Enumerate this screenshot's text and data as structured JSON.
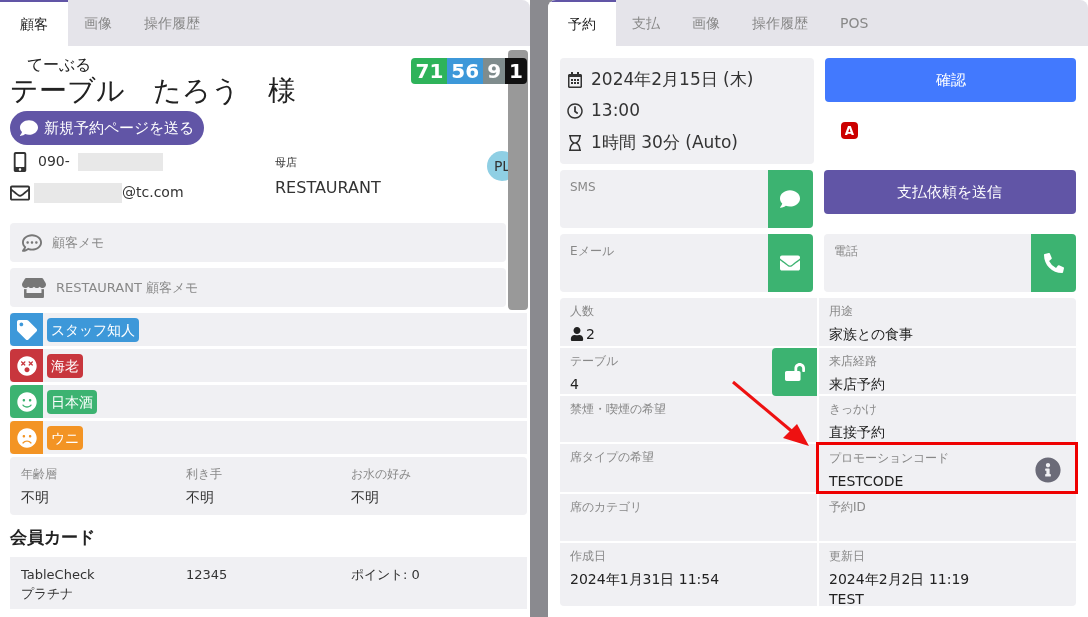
{
  "left_panel": {
    "tabs": [
      {
        "label": "顧客",
        "selected": true
      },
      {
        "label": "画像",
        "selected": false
      },
      {
        "label": "操作履歴",
        "selected": false
      }
    ],
    "customer": {
      "furigana": "てーぶる",
      "name": "テーブル　たろう　様",
      "scores": [
        {
          "value": "71",
          "color": "#2eb35a"
        },
        {
          "value": "56",
          "color": "#3d98d9"
        },
        {
          "value": "9",
          "color": "#7f8c8d"
        },
        {
          "value": "1",
          "color": "#111111"
        }
      ],
      "send_button": "新規予約ページを送る",
      "phone": "090-",
      "email": "@tc.com",
      "home_store": {
        "label": "母店",
        "value": "RESTAURANT"
      },
      "avatar": "PL"
    },
    "memos": [
      {
        "kind": "chat",
        "text": "顧客メモ"
      },
      {
        "kind": "store",
        "text": "RESTAURANT 顧客メモ"
      }
    ],
    "tags": [
      {
        "kind": "tag",
        "label": "スタッフ知人",
        "color": "#3d98d9"
      },
      {
        "kind": "dizzy",
        "label": "海老",
        "color": "#c8363d"
      },
      {
        "kind": "smile",
        "label": "日本酒",
        "color": "#3cb371"
      },
      {
        "kind": "frown",
        "label": "ウニ",
        "color": "#f39424"
      }
    ],
    "attributes": [
      {
        "label": "年齢層",
        "value": "不明"
      },
      {
        "label": "利き手",
        "value": "不明"
      },
      {
        "label": "お水の好み",
        "value": "不明"
      }
    ],
    "membership": {
      "heading": "会員カード",
      "card": {
        "name": "TableCheck\nプラチナ",
        "number": "12345",
        "points": "ポイント: 0"
      }
    }
  },
  "right_panel": {
    "tabs": [
      {
        "label": "予約",
        "selected": true
      },
      {
        "label": "支払",
        "selected": false
      },
      {
        "label": "画像",
        "selected": false
      },
      {
        "label": "操作履歴",
        "selected": false
      },
      {
        "label": "POS",
        "selected": false
      }
    ],
    "date": "2024年2月15日 (木)",
    "time": "13:00",
    "duration": "1時間 30分 (Auto)",
    "confirm_button": "確認",
    "badge": "A",
    "pay_button": "支払依頼を送信",
    "contacts": [
      {
        "kind": "sms",
        "label": "SMS"
      },
      {
        "kind": "email",
        "label": "Eメール"
      },
      {
        "kind": "phone",
        "label": "電話"
      }
    ],
    "details": [
      [
        {
          "label": "人数",
          "value": "2",
          "kind": "party"
        },
        {
          "label": "用途",
          "value": "家族との食事"
        }
      ],
      [
        {
          "label": "テーブル",
          "value": "4",
          "kind": "table",
          "locked": false
        },
        {
          "label": "来店経路",
          "value": "来店予約"
        }
      ],
      [
        {
          "label": "禁煙・喫煙の希望"
        },
        {
          "label": "きっかけ",
          "value": "直接予約"
        }
      ],
      [
        {
          "label": "席タイプの希望"
        },
        {
          "label": "プロモーションコード",
          "value": "TESTCODE",
          "highlighted": true
        }
      ],
      [
        {
          "label": "席のカテゴリ"
        },
        {
          "label": "予約ID"
        }
      ],
      [
        {
          "label": "作成日",
          "value": "2024年1月31日 11:54"
        },
        {
          "label": "更新日",
          "value": "2024年2月2日 11:19\nTEST"
        }
      ]
    ]
  }
}
